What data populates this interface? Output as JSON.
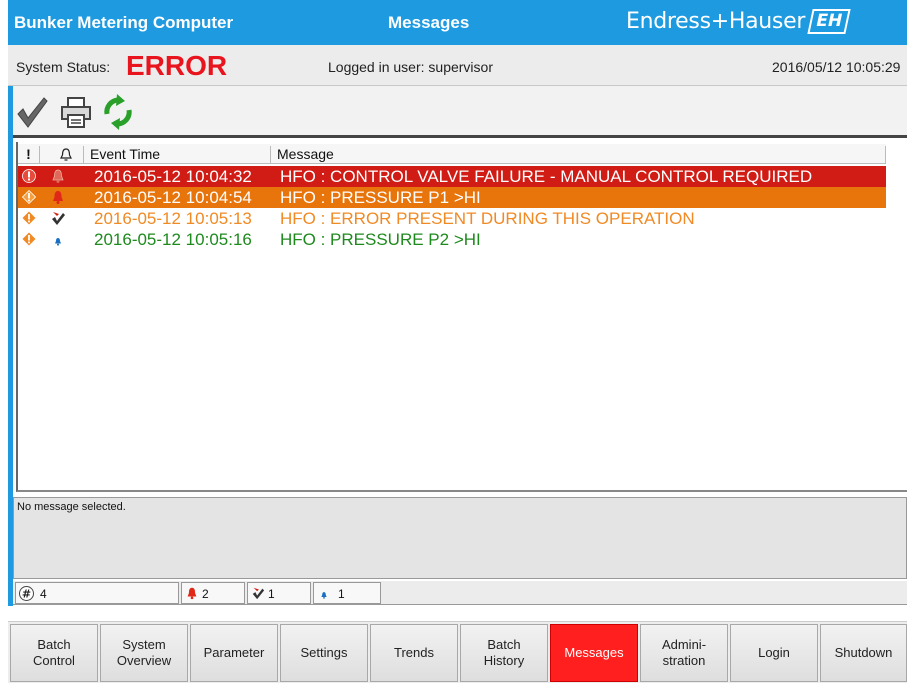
{
  "header": {
    "app_title": "Bunker Metering Computer",
    "screen_title": "Messages",
    "brand": "Endress+Hauser",
    "logo": "EH"
  },
  "status": {
    "label": "System Status:",
    "value": "ERROR",
    "user": "Logged in user: supervisor",
    "datetime": "2016/05/12 10:05:29"
  },
  "toolbar": {
    "icons": [
      "check-icon",
      "printer-icon",
      "refresh-icon"
    ]
  },
  "list": {
    "headers": {
      "prio": "!",
      "bell": "",
      "time": "Event Time",
      "message": "Message"
    },
    "rows": [
      {
        "time": "2016-05-12 10:04:32",
        "message": "HFO : CONTROL VALVE FAILURE - MANUAL CONTROL REQUIRED",
        "state": "active-critical",
        "bg": "#d01c14",
        "fg": "#ffffff"
      },
      {
        "time": "2016-05-12 10:04:54",
        "message": "HFO : PRESSURE P1 >HI",
        "state": "active-warning",
        "bg": "#e8740c",
        "fg": "#ffffff"
      },
      {
        "time": "2016-05-12 10:05:13",
        "message": "HFO : ERROR PRESENT DURING THIS OPERATION",
        "state": "acknowledged",
        "bg": "#ffffff",
        "fg": "#f08a24"
      },
      {
        "time": "2016-05-12 10:05:16",
        "message": "HFO : PRESSURE P2 >HI",
        "state": "cleared",
        "bg": "#ffffff",
        "fg": "#1e8a1e"
      }
    ]
  },
  "detail": {
    "text": "No message selected."
  },
  "counters": {
    "total": "4",
    "active": "2",
    "acknowledged": "1",
    "cleared": "1"
  },
  "nav": [
    {
      "label": "Batch\nControl",
      "active": false
    },
    {
      "label": "System\nOverview",
      "active": false
    },
    {
      "label": "Parameter",
      "active": false
    },
    {
      "label": "Settings",
      "active": false
    },
    {
      "label": "Trends",
      "active": false
    },
    {
      "label": "Batch\nHistory",
      "active": false
    },
    {
      "label": "Messages",
      "active": true
    },
    {
      "label": "Admini-\nstration",
      "active": false
    },
    {
      "label": "Login",
      "active": false
    },
    {
      "label": "Shutdown",
      "active": false
    }
  ],
  "colors": {
    "accent": "#1e9be0",
    "error": "#e8141e",
    "active_nav": "#ff1f1f"
  }
}
